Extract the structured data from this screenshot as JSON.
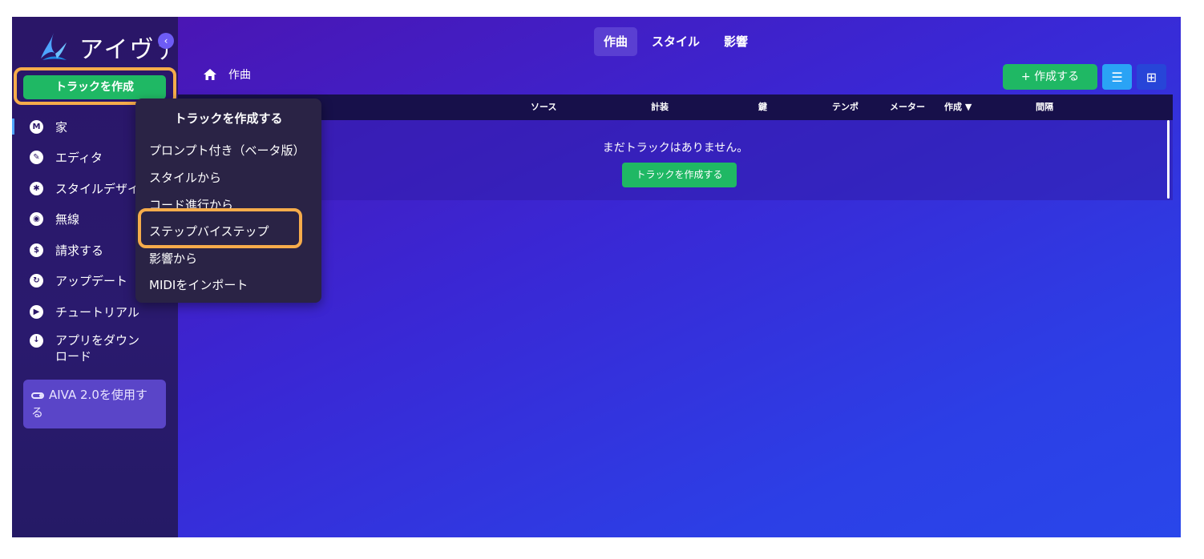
{
  "app": {
    "logo_text": "アイヴァ"
  },
  "sidebar": {
    "create_button": "トラックを作成",
    "collapse_icon": "‹",
    "items": [
      {
        "label": "家",
        "icon": "music-icon",
        "glyph": "M"
      },
      {
        "label": "エディタ",
        "icon": "pencil-icon",
        "glyph": "✎"
      },
      {
        "label": "スタイルデザイナー",
        "icon": "style-icon",
        "glyph": "✱"
      },
      {
        "label": "無線",
        "icon": "radio-icon",
        "glyph": "◉"
      },
      {
        "label": "請求する",
        "icon": "dollar-icon",
        "glyph": "$"
      },
      {
        "label": "アップデート",
        "icon": "update-icon",
        "glyph": "↻"
      },
      {
        "label": "チュートリアル",
        "icon": "play-icon",
        "glyph": "▶"
      },
      {
        "label": "アプリをダウンロード",
        "icon": "download-icon",
        "glyph": "↓"
      }
    ],
    "aiva_toggle": "AIVA 2.0を使用する"
  },
  "header": {
    "tabs": [
      "作曲",
      "スタイル",
      "影響"
    ],
    "active_tab": "作曲",
    "breadcrumb": "作曲",
    "new_button": "+ 作成する",
    "list_view_icon": "☰",
    "grid_view_icon": "⊞"
  },
  "table": {
    "columns": [
      "ソース",
      "計装",
      "鍵",
      "テンポ",
      "メーター",
      "作成 ▼",
      "間隔"
    ],
    "empty_text": "まだトラックはありません。",
    "empty_button": "トラックを作成する"
  },
  "menu": {
    "title": "トラックを作成する",
    "items": [
      "プロンプト付き（ベータ版）",
      "スタイルから",
      "コード進行から",
      "ステップバイステップ",
      "影響から",
      "MIDIをインポート"
    ],
    "highlighted": "ステップバイステップ"
  },
  "colors": {
    "accent_green": "#1fb864",
    "highlight_orange": "#f6ac4b",
    "active_blue": "#2aa3f5"
  }
}
